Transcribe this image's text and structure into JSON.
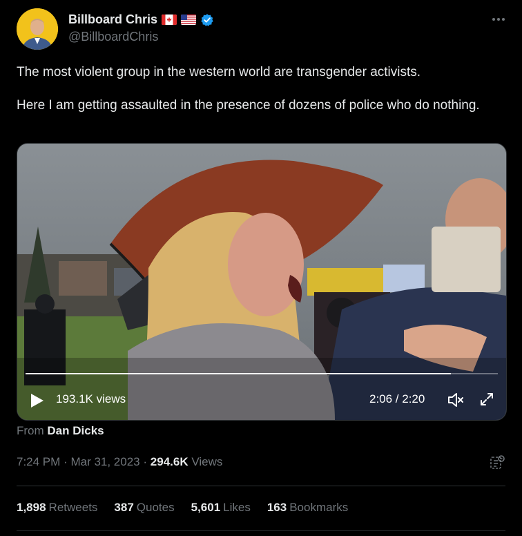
{
  "author": {
    "name": "Billboard Chris",
    "handle": "@BillboardChris",
    "flags": [
      "canada-flag-icon",
      "usa-flag-icon"
    ],
    "verified_icon": "verified-badge-icon"
  },
  "more_icon": "more-options-icon",
  "tweet": {
    "line1": "The most violent group in the western world are transgender activists.",
    "line2": "Here I am getting assaulted in the presence of dozens of police who do nothing."
  },
  "video": {
    "views": "193.1K views",
    "time": "2:06 / 2:20",
    "progress": 0.9
  },
  "source": {
    "prefix": "From",
    "name": "Dan Dicks"
  },
  "meta": {
    "time": "7:24 PM",
    "date": "Mar 31, 2023",
    "views_count": "294.6K",
    "views_label": "Views",
    "separator": "·"
  },
  "stats": [
    {
      "count": "1,898",
      "label": "Retweets"
    },
    {
      "count": "387",
      "label": "Quotes"
    },
    {
      "count": "5,601",
      "label": "Likes"
    },
    {
      "count": "163",
      "label": "Bookmarks"
    }
  ],
  "colors": {
    "background": "#000000",
    "text": "#e7e9ea",
    "muted": "#71767b",
    "verified": "#1d9bf0",
    "divider": "#2f3336"
  }
}
